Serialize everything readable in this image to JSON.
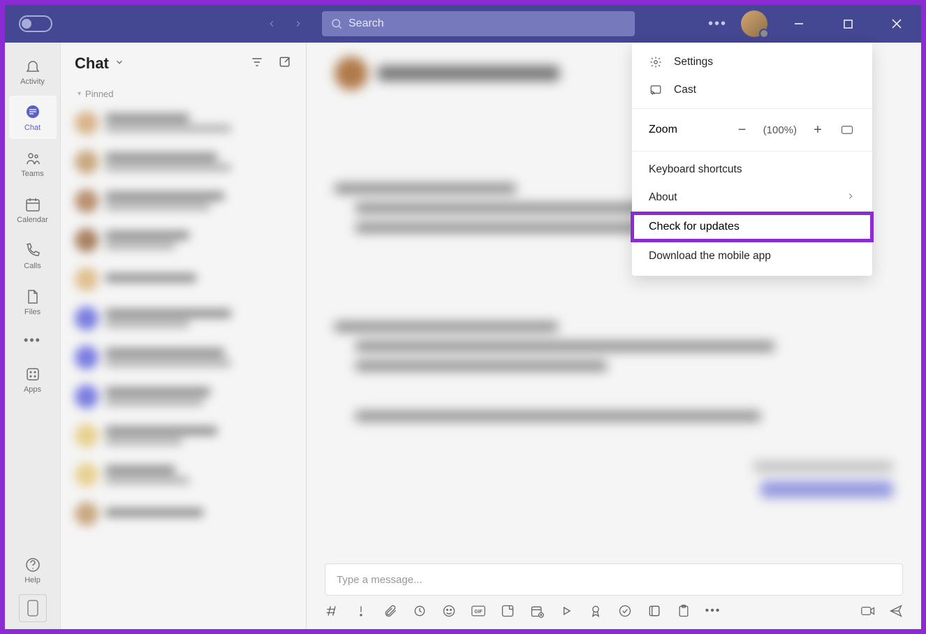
{
  "search": {
    "placeholder": "Search"
  },
  "rail": {
    "activity": "Activity",
    "chat": "Chat",
    "teams": "Teams",
    "calendar": "Calendar",
    "calls": "Calls",
    "files": "Files",
    "apps": "Apps",
    "help": "Help"
  },
  "chat_panel": {
    "title": "Chat",
    "pinned_label": "Pinned"
  },
  "dropdown": {
    "settings": "Settings",
    "cast": "Cast",
    "zoom_label": "Zoom",
    "zoom_value": "(100%)",
    "keyboard": "Keyboard shortcuts",
    "about": "About",
    "check_updates": "Check for updates",
    "download_app": "Download the mobile app"
  },
  "compose": {
    "placeholder": "Type a message..."
  }
}
